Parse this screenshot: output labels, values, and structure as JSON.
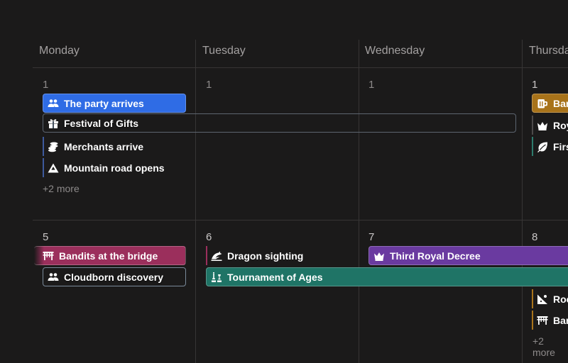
{
  "days": [
    "Monday",
    "Tuesday",
    "Wednesday",
    "Thursday"
  ],
  "week1": {
    "dates": [
      "1",
      "1",
      "1",
      "1"
    ],
    "events": [
      {
        "name": "event-the-party-arrives",
        "label": "The party arrives",
        "icon": "people-icon",
        "color": "#2f6ce5"
      },
      {
        "name": "event-festival-of-gifts",
        "label": "Festival of Gifts",
        "icon": "gift-icon",
        "color": "#44505e"
      },
      {
        "name": "event-merchants-arrive",
        "label": "Merchants arrive",
        "icon": "coins-icon",
        "color": "#3d5a9c"
      },
      {
        "name": "event-mountain-road-opens",
        "label": "Mountain road opens",
        "icon": "mountain-icon",
        "color": "#3d5a9c"
      },
      {
        "name": "event-bar",
        "label": "Bar",
        "icon": "mug-icon",
        "color": "#a8731a"
      },
      {
        "name": "event-roy",
        "label": "Roy",
        "icon": "crown-icon",
        "color": "#4d4a4a"
      },
      {
        "name": "event-firs",
        "label": "Firs",
        "icon": "leaf-icon",
        "color": "#2e7a6b"
      }
    ],
    "more": "+2 more"
  },
  "week2": {
    "dates": [
      "5",
      "6",
      "7",
      "8"
    ],
    "events": [
      {
        "name": "event-bandits-at-the-bridge",
        "label": "Bandits at the bridge",
        "icon": "bridge-icon",
        "color": "#9b2f5c"
      },
      {
        "name": "event-cloudborn-discovery",
        "label": "Cloudborn discovery",
        "icon": "people-icon",
        "color": "#6f86a6"
      },
      {
        "name": "event-dragon-sighting",
        "label": "Dragon sighting",
        "icon": "dragon-icon",
        "color": "#9b2f5c"
      },
      {
        "name": "event-tournament-of-ages",
        "label": "Tournament of Ages",
        "icon": "chess-icon",
        "color": "#1f7466"
      },
      {
        "name": "event-third-royal-decree",
        "label": "Third Royal Decree",
        "icon": "crown-icon",
        "color": "#6a3aa0"
      },
      {
        "name": "event-roc",
        "label": "Roc",
        "icon": "rockslide-icon",
        "color": "#a8731a"
      },
      {
        "name": "event-bar-2",
        "label": "Bar",
        "icon": "bridge-icon",
        "color": "#a8731a"
      }
    ],
    "more": "+2 more"
  }
}
